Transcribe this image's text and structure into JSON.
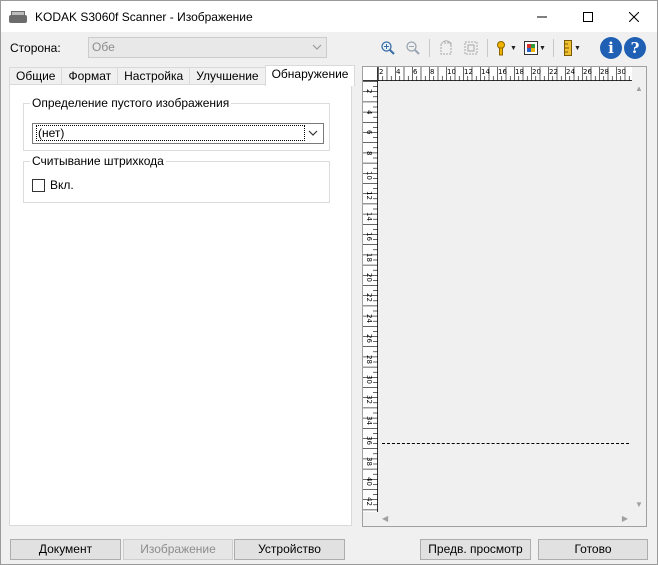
{
  "window": {
    "title": "KODAK S3060f Scanner - Изображение"
  },
  "side": {
    "label": "Сторона:",
    "value": "Обе"
  },
  "tabs": [
    {
      "label": "Общие"
    },
    {
      "label": "Формат"
    },
    {
      "label": "Настройка"
    },
    {
      "label": "Улучшение"
    },
    {
      "label": "Обнаружение"
    }
  ],
  "blank_image": {
    "title": "Определение пустого изображения",
    "value": "(нет)"
  },
  "barcode": {
    "title": "Считывание штрихкода",
    "checkbox_label": "Вкл.",
    "checked": false
  },
  "ruler": {
    "top_labels": [
      "2",
      "4",
      "6",
      "8",
      "10",
      "12",
      "14",
      "16",
      "18",
      "20",
      "22",
      "24",
      "26",
      "28",
      "30"
    ],
    "left_labels": [
      "2",
      "4",
      "6",
      "8",
      "10",
      "12",
      "14",
      "16",
      "18",
      "20",
      "22",
      "24",
      "26",
      "28",
      "30",
      "32",
      "34",
      "36",
      "38",
      "40",
      "42"
    ]
  },
  "buttons": {
    "document": "Документ",
    "image": "Изображение",
    "device": "Устройство",
    "preview": "Предв. просмотр",
    "done": "Готово"
  },
  "info": {
    "info_glyph": "i",
    "help_glyph": "?"
  }
}
